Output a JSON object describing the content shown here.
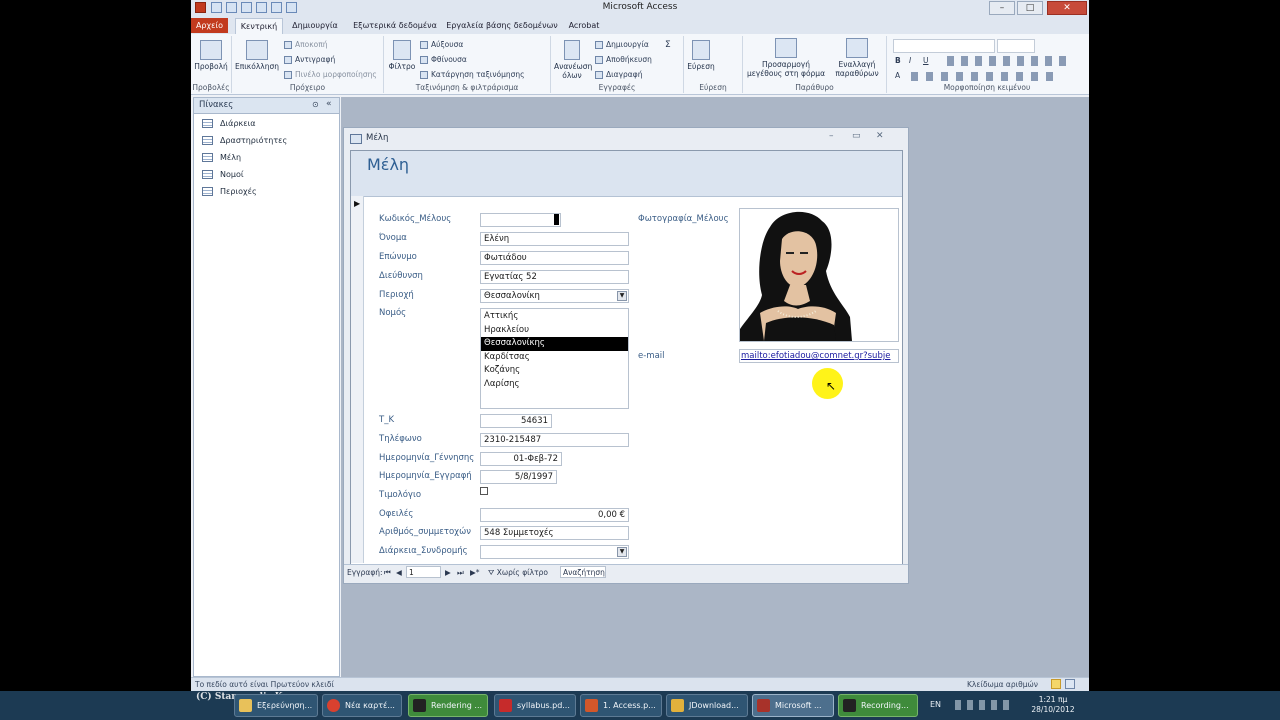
{
  "app": {
    "title": "Microsoft Access",
    "tabs": [
      "Αρχείο",
      "Κεντρική",
      "Δημιουργία",
      "Εξωτερικά δεδομένα",
      "Εργαλεία βάσης δεδομένων",
      "Acrobat"
    ]
  },
  "ribbon": {
    "views": {
      "button": "Προβολή",
      "group": "Προβολές"
    },
    "clipboard": {
      "paste": "Επικόλληση",
      "cut": "Αποκοπή",
      "copy": "Αντιγραφή",
      "format_painter": "Πινέλο μορφοποίησης",
      "group": "Πρόχειρο"
    },
    "sort_filter": {
      "filter": "Φίλτρο",
      "ascending": "Αύξουσα",
      "descending": "Φθίνουσα",
      "remove_sort": "Κατάργηση ταξινόμησης",
      "group": "Ταξινόμηση & φιλτράρισμα"
    },
    "records": {
      "refresh": "Ανανέωση όλων",
      "new": "Δημιουργία",
      "save": "Αποθήκευση",
      "delete": "Διαγραφή",
      "totals": "Σ",
      "group": "Εγγραφές"
    },
    "find": {
      "find": "Εύρεση",
      "group": "Εύρεση"
    },
    "window": {
      "fit": "Προσαρμογή μεγέθους στη φόρμα",
      "switch": "Εναλλαγή παραθύρων",
      "group": "Παράθυρο"
    },
    "text_format": {
      "bold": "B",
      "italic": "I",
      "underline": "U",
      "font_color": "A",
      "group": "Μορφοποίηση κειμένου"
    }
  },
  "nav": {
    "title": "Πίνακες",
    "items": [
      "Διάρκεια",
      "Δραστηριότητες",
      "Μέλη",
      "Νομοί",
      "Περιοχές"
    ]
  },
  "form": {
    "window_title": "Μέλη",
    "header": "Μέλη",
    "labels": {
      "id": "Κωδικός_Μέλους",
      "first_name": "Όνομα",
      "last_name": "Επώνυμο",
      "address": "Διεύθυνση",
      "area": "Περιοχή",
      "prefecture": "Νομός",
      "postal": "Τ_Κ",
      "phone": "Τηλέφωνο",
      "birth_date": "Ημερομηνία_Γέννησης",
      "reg_date": "Ημερομηνία_Εγγραφή",
      "invoice": "Τιμολόγιο",
      "debt": "Οφειλές",
      "participations": "Αριθμός_συμμετοχών",
      "duration": "Διάρκεια_Συνδρομής",
      "photo": "Φωτογραφία_Μέλους",
      "email": "e-mail"
    },
    "values": {
      "id": "",
      "first_name": "Ελένη",
      "last_name": "Φωτιάδου",
      "address": "Εγνατίας 52",
      "area": "Θεσσαλονίκη",
      "prefecture_options": [
        "Αττικής",
        "Ηρακλείου",
        "Θεσσαλονίκης",
        "Καρδίτσας",
        "Κοζάνης",
        "Λαρίσης"
      ],
      "prefecture_selected": "Θεσσαλονίκης",
      "postal": "54631",
      "phone": "2310-215487",
      "birth_date": "01-Φεβ-72",
      "reg_date": "5/8/1997",
      "invoice": false,
      "debt": "0,00 €",
      "participations": "548 Συμμετοχές",
      "duration": "",
      "email": "mailto:efotiadou@comnet.gr?subje"
    },
    "record_nav": {
      "label": "Εγγραφή:",
      "current": "1",
      "filter": "Χωρίς φίλτρο",
      "search": "Αναζήτηση"
    }
  },
  "status": {
    "left": "Το πεδίο αυτό είναι Πρωτεύον κλειδί",
    "right": "Κλείδωμα αριθμών"
  },
  "taskbar": {
    "items": [
      "Εξερεύνηση...",
      "Νέα καρτέ...",
      "Rendering ...",
      "syllabus.pd...",
      "1. Access.p...",
      "JDownload...",
      "Microsoft ...",
      "Recording..."
    ],
    "lang": "EN",
    "time": "1:21 πμ",
    "date": "28/10/2012"
  },
  "watermark": "(C) Stampoulis K.",
  "colors": {
    "accent": "#2e5f93",
    "file_tab": "#c23a1e",
    "taskbar": "#1c3a53"
  }
}
